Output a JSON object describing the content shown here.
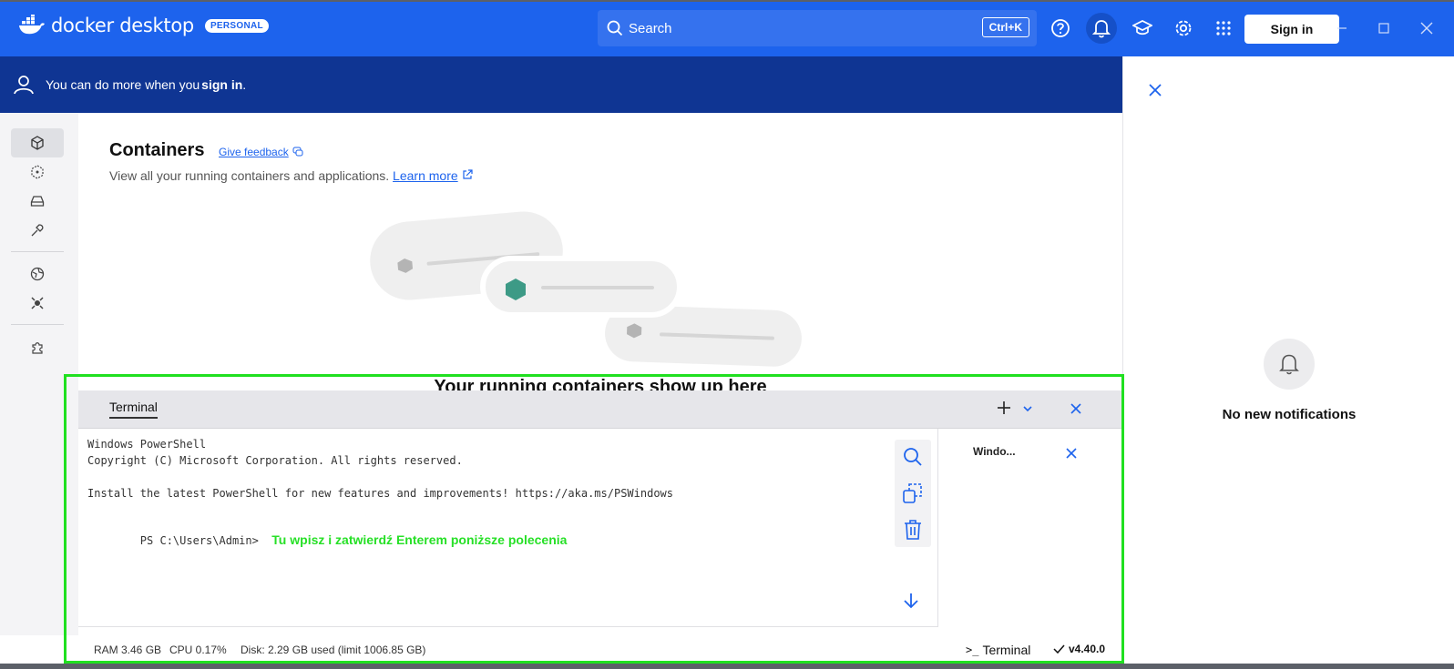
{
  "titlebar": {
    "app_name": "docker desktop",
    "plan_badge": "PERSONAL",
    "search_placeholder": "Search",
    "search_shortcut": "Ctrl+K",
    "sign_in_label": "Sign in",
    "accent_color": "#1d63ed"
  },
  "banner": {
    "text_prefix": "You can do more when you",
    "link_text": "sign in",
    "text_suffix": "."
  },
  "sidebar": {
    "items": [
      {
        "icon": "containers-icon",
        "active": true
      },
      {
        "icon": "images-icon"
      },
      {
        "icon": "volumes-icon"
      },
      {
        "icon": "builds-icon"
      },
      {
        "icon": "docker-hub-icon"
      },
      {
        "icon": "docker-scout-icon"
      },
      {
        "icon": "extensions-icon"
      }
    ]
  },
  "main": {
    "title": "Containers",
    "feedback_label": "Give feedback",
    "subtitle": "View all your running containers and applications.",
    "learn_more": "Learn more",
    "empty_title": "Your running containers show up here"
  },
  "terminal": {
    "tab_label": "Terminal",
    "lines": [
      "Windows PowerShell",
      "Copyright (C) Microsoft Corporation. All rights reserved.",
      "",
      "Install the latest PowerShell for new features and improvements! https://aka.ms/PSWindows",
      ""
    ],
    "prompt": "PS C:\\Users\\Admin>",
    "annotation": "Tu wpisz i zatwierdź Enterem poniższe polecenia",
    "session_label": "Windo..."
  },
  "statusbar": {
    "ram": "RAM 3.46 GB",
    "cpu": "CPU 0.17%",
    "disk": "Disk: 2.29 GB used (limit 1006.85 GB)",
    "terminal_label": "Terminal",
    "version": "v4.40.0"
  },
  "notifications": {
    "empty_text": "No new notifications"
  }
}
